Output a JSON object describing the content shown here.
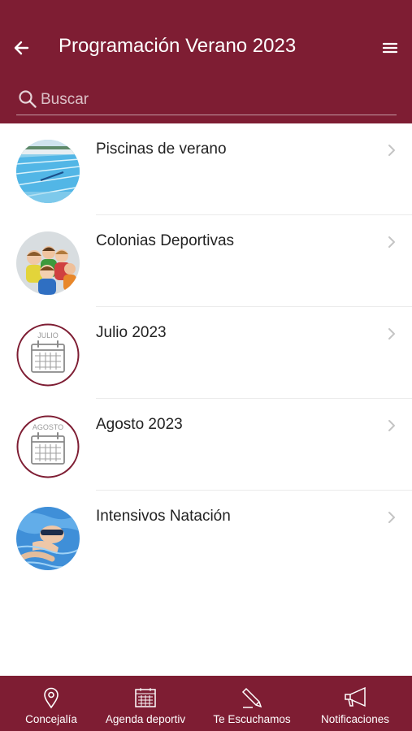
{
  "header": {
    "title": "Programación Verano 2023",
    "back_icon": "back-arrow-icon",
    "menu_icon": "hamburger-menu-icon",
    "search_placeholder": "Buscar",
    "search_value": ""
  },
  "list": {
    "items": [
      {
        "label": "Piscinas de verano",
        "thumb": "swimming-pool-photo"
      },
      {
        "label": "Colonias Deportivas",
        "thumb": "children-group-photo"
      },
      {
        "label": "Julio 2023",
        "thumb": "calendar-icon",
        "calendar_caption": "JULIO"
      },
      {
        "label": "Agosto 2023",
        "thumb": "calendar-icon",
        "calendar_caption": "AGOSTO"
      },
      {
        "label": "Intensivos Natación",
        "thumb": "swimmer-photo"
      }
    ]
  },
  "tabbar": {
    "tabs": [
      {
        "label": "Concejalía",
        "icon": "location-pin-icon"
      },
      {
        "label": "Agenda deportiv",
        "icon": "calendar-icon"
      },
      {
        "label": "Te Escuchamos",
        "icon": "pencil-icon"
      },
      {
        "label": "Notificaciones",
        "icon": "megaphone-icon"
      }
    ]
  },
  "colors": {
    "brand": "#7e1d33",
    "background": "#ffffff",
    "text": "#222222",
    "separator": "#ebebeb",
    "chevron": "#c4c4c4"
  }
}
